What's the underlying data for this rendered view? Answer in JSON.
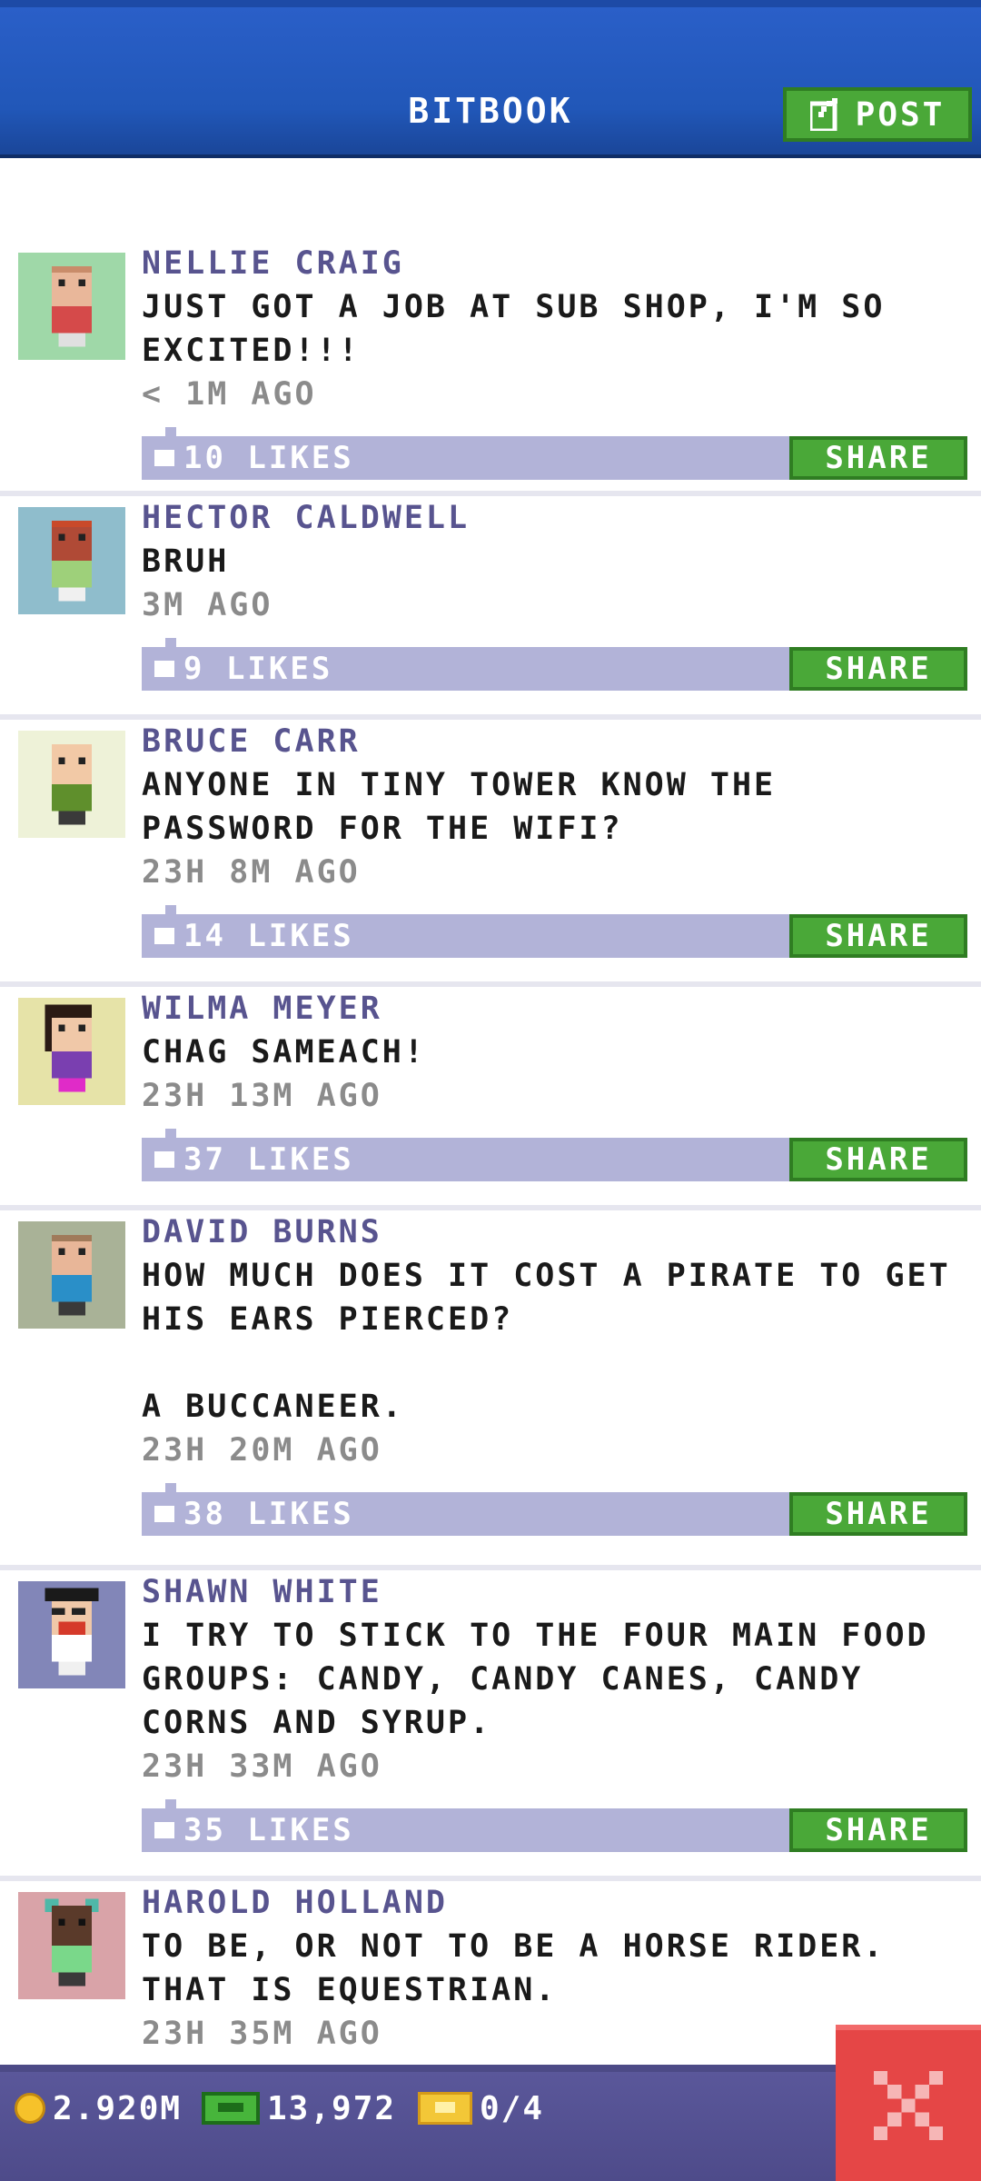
{
  "header": {
    "title": "BITBOOK",
    "post_label": "POST"
  },
  "posts": [
    {
      "author": "NELLIE CRAIG",
      "text": "JUST GOT A JOB AT SUB SHOP, I'M SO EXCITED!!!",
      "time": "< 1M AGO",
      "likes": "10 LIKES",
      "share": "SHARE",
      "avatar_bg": "#9fd8a8",
      "skin": "#e9b79a",
      "hair": "#c98c6a",
      "shirt": "#d54a4a",
      "pants": "#e0e0e0"
    },
    {
      "author": "HECTOR CALDWELL",
      "text": "BRUH",
      "time": "3M AGO",
      "likes": "9 LIKES",
      "share": "SHARE",
      "avatar_bg": "#8fbdcc",
      "skin": "#b04a36",
      "hair": "#c94a2a",
      "shirt": "#9ed07a",
      "pants": "#f0f0f0"
    },
    {
      "author": "BRUCE CARR",
      "text": "ANYONE IN TINY TOWER KNOW THE PASSWORD FOR THE WIFI?",
      "time": "23H 8M AGO",
      "likes": "14 LIKES",
      "share": "SHARE",
      "avatar_bg": "#eef2d8",
      "skin": "#f2c9a6",
      "hair": "#f2c9a6",
      "shirt": "#5f8f2c",
      "pants": "#3a3a3a"
    },
    {
      "author": "WILMA MEYER",
      "text": "CHAG SAMEACH!",
      "time": "23H 13M AGO",
      "likes": "37 LIKES",
      "share": "SHARE",
      "avatar_bg": "#e6e3a8",
      "skin": "#f0c8a8",
      "hair": "#2a1a14",
      "shirt": "#7a3fb0",
      "pants": "#e02bc8"
    },
    {
      "author": "DAVID BURNS",
      "text": "HOW MUCH DOES IT COST A PIRATE TO GET HIS EARS PIERCED?\n\nA BUCCANEER.",
      "time": "23H 20M AGO",
      "likes": "38 LIKES",
      "share": "SHARE",
      "avatar_bg": "#a9b297",
      "skin": "#e8b698",
      "hair": "#a07a5a",
      "shirt": "#2a8fc8",
      "pants": "#3a3a3a"
    },
    {
      "author": "SHAWN WHITE",
      "text": "I TRY TO STICK TO THE FOUR MAIN FOOD GROUPS: CANDY, CANDY CANES, CANDY CORNS AND SYRUP.",
      "time": "23H 33M AGO",
      "likes": "35 LIKES",
      "share": "SHARE",
      "avatar_bg": "#8286b8",
      "skin": "#f0c8a8",
      "hair": "#1a1a1a",
      "shirt": "#ffffff",
      "pants": "#f0f0f0"
    },
    {
      "author": "HAROLD HOLLAND",
      "text": "TO BE, OR NOT TO BE A HORSE RIDER. THAT IS EQUESTRIAN.",
      "time": "23H 35M AGO",
      "likes": "",
      "share": "",
      "avatar_bg": "#d9a3a8",
      "skin": "#5a3a2a",
      "hair": "#4fb8a8",
      "shirt": "#7ad88a",
      "pants": "#3a3a3a"
    }
  ],
  "bottom_bar": {
    "coins": "2.920M",
    "bux": "13,972",
    "tickets": "0/4"
  },
  "colors": {
    "header_blue": "#2157b8",
    "green_button": "#4aa838",
    "likes_bar": "#b2b3d8",
    "author": "#58548f",
    "bottom_bar": "#5a579a",
    "close_red": "#e54646"
  }
}
